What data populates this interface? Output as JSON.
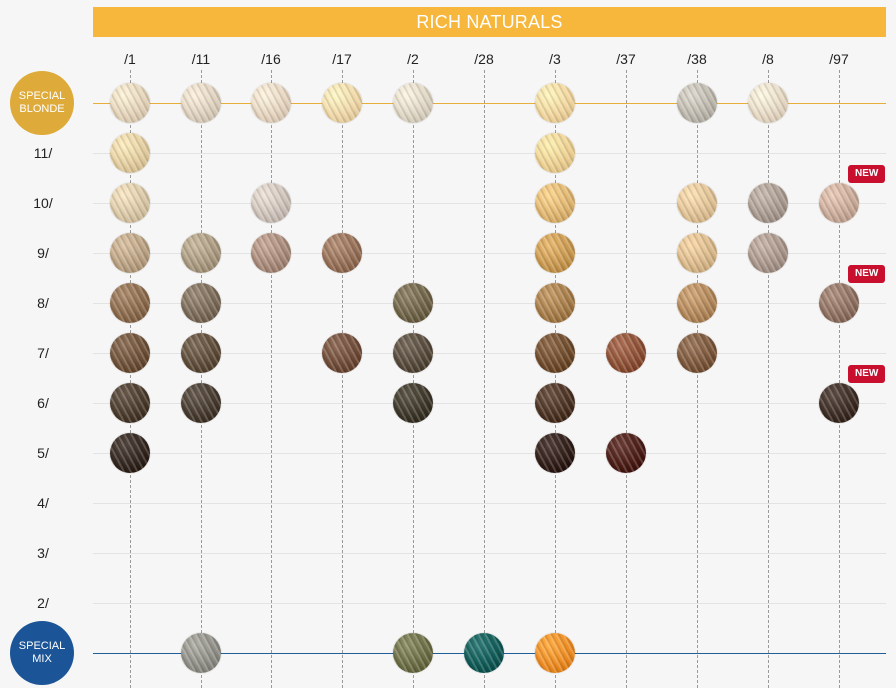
{
  "header": {
    "title": "RICH NATURALS"
  },
  "colors": {
    "banner": "#f6b73c",
    "special_blonde": "#deab3a",
    "special_mix": "#1b5597",
    "new_tag": "#c8102e"
  },
  "columns": [
    "/1",
    "/11",
    "/16",
    "/17",
    "/2",
    "/28",
    "/3",
    "/37",
    "/38",
    "/8",
    "/97"
  ],
  "rows": {
    "special_blonde": {
      "label": "SPECIAL BLONDE"
    },
    "levels": [
      "11/",
      "10/",
      "9/",
      "8/",
      "7/",
      "6/",
      "5/",
      "4/",
      "3/",
      "2/"
    ],
    "special_mix": {
      "label": "SPECIAL MIX"
    }
  },
  "new_label": "NEW",
  "swatches": [
    {
      "row": "SB",
      "col": "/1",
      "color": "#e3d2b8"
    },
    {
      "row": "SB",
      "col": "/11",
      "color": "#ddd0bd"
    },
    {
      "row": "SB",
      "col": "/16",
      "color": "#e5d3be"
    },
    {
      "row": "SB",
      "col": "/17",
      "color": "#efd6a6"
    },
    {
      "row": "SB",
      "col": "/2",
      "color": "#ddd4c2"
    },
    {
      "row": "SB",
      "col": "/3",
      "color": "#f1d49c"
    },
    {
      "row": "SB",
      "col": "/38",
      "color": "#bdb8ad"
    },
    {
      "row": "SB",
      "col": "/8",
      "color": "#e6d8c3"
    },
    {
      "row": "11/",
      "col": "/1",
      "color": "#e2cc9e"
    },
    {
      "row": "11/",
      "col": "/3",
      "color": "#edcf91"
    },
    {
      "row": "10/",
      "col": "/1",
      "color": "#d9c7a5"
    },
    {
      "row": "10/",
      "col": "/16",
      "color": "#cdc2b9"
    },
    {
      "row": "10/",
      "col": "/3",
      "color": "#dfb56f"
    },
    {
      "row": "10/",
      "col": "/38",
      "color": "#e0c194"
    },
    {
      "row": "10/",
      "col": "/8",
      "color": "#a89a8f"
    },
    {
      "row": "10/",
      "col": "/97",
      "color": "#c9aa98",
      "new": true
    },
    {
      "row": "9/",
      "col": "/1",
      "color": "#b9a182"
    },
    {
      "row": "9/",
      "col": "/11",
      "color": "#a9997f"
    },
    {
      "row": "9/",
      "col": "/16",
      "color": "#a88a79"
    },
    {
      "row": "9/",
      "col": "/17",
      "color": "#946e55"
    },
    {
      "row": "9/",
      "col": "/3",
      "color": "#c9984f"
    },
    {
      "row": "9/",
      "col": "/38",
      "color": "#d9b889"
    },
    {
      "row": "9/",
      "col": "/8",
      "color": "#a8958a"
    },
    {
      "row": "8/",
      "col": "/1",
      "color": "#8b6a4c"
    },
    {
      "row": "8/",
      "col": "/11",
      "color": "#7a6a57"
    },
    {
      "row": "8/",
      "col": "/2",
      "color": "#6e6247"
    },
    {
      "row": "8/",
      "col": "/3",
      "color": "#a57b47"
    },
    {
      "row": "8/",
      "col": "/38",
      "color": "#b18658"
    },
    {
      "row": "8/",
      "col": "/97",
      "color": "#8e7060",
      "new": true
    },
    {
      "row": "7/",
      "col": "/1",
      "color": "#6d5037"
    },
    {
      "row": "7/",
      "col": "/11",
      "color": "#5d4b38"
    },
    {
      "row": "7/",
      "col": "/17",
      "color": "#6f4b37"
    },
    {
      "row": "7/",
      "col": "/2",
      "color": "#55493a"
    },
    {
      "row": "7/",
      "col": "/3",
      "color": "#6e4a2a"
    },
    {
      "row": "7/",
      "col": "/37",
      "color": "#8c4e33"
    },
    {
      "row": "7/",
      "col": "/38",
      "color": "#7a563a"
    },
    {
      "row": "6/",
      "col": "/1",
      "color": "#4a3a2c"
    },
    {
      "row": "6/",
      "col": "/11",
      "color": "#463a2e"
    },
    {
      "row": "6/",
      "col": "/2",
      "color": "#3c3628"
    },
    {
      "row": "6/",
      "col": "/3",
      "color": "#4a3121"
    },
    {
      "row": "6/",
      "col": "/97",
      "color": "#3c2c24",
      "new": true
    },
    {
      "row": "5/",
      "col": "/1",
      "color": "#32261e"
    },
    {
      "row": "5/",
      "col": "/3",
      "color": "#2f1c16"
    },
    {
      "row": "5/",
      "col": "/37",
      "color": "#4a1c15"
    },
    {
      "row": "SM",
      "col": "/11",
      "color": "#8f8e86"
    },
    {
      "row": "SM",
      "col": "/2",
      "color": "#6b6d45"
    },
    {
      "row": "SM",
      "col": "/28",
      "color": "#0f5a56"
    },
    {
      "row": "SM",
      "col": "/3",
      "color": "#ed8b22"
    }
  ]
}
